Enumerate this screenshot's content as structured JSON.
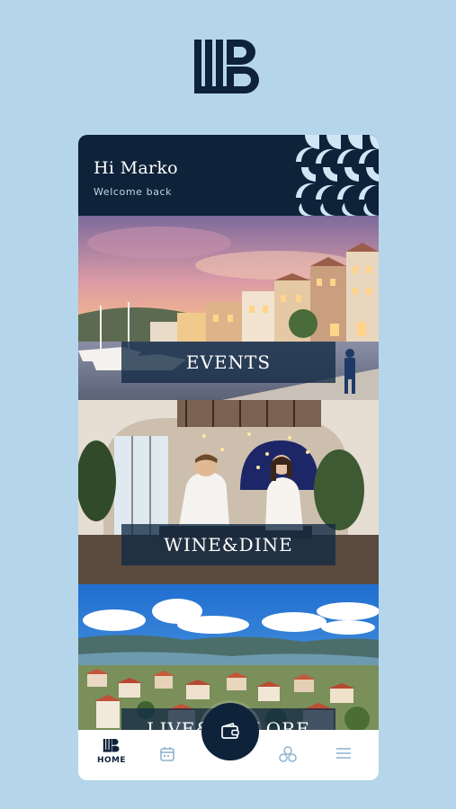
{
  "brand": {
    "logo_text": "LB"
  },
  "header": {
    "greeting": "Hi Marko",
    "subtitle": "Welcome back"
  },
  "tiles": [
    {
      "label": "EVENTS"
    },
    {
      "label": "WINE&DINE"
    },
    {
      "label": "LIVE&EXPLORE"
    }
  ],
  "nav": {
    "items": [
      {
        "icon": "lb-logo-icon",
        "label": "HOME",
        "active": true
      },
      {
        "icon": "calendar-icon",
        "label": ""
      },
      {
        "icon": "wallet-icon",
        "label": ""
      },
      {
        "icon": "circles-icon",
        "label": ""
      },
      {
        "icon": "menu-icon",
        "label": ""
      }
    ]
  },
  "colors": {
    "background": "#b5d6ea",
    "navy": "#0e2239",
    "nav_icon_inactive": "#8fb4cf"
  }
}
